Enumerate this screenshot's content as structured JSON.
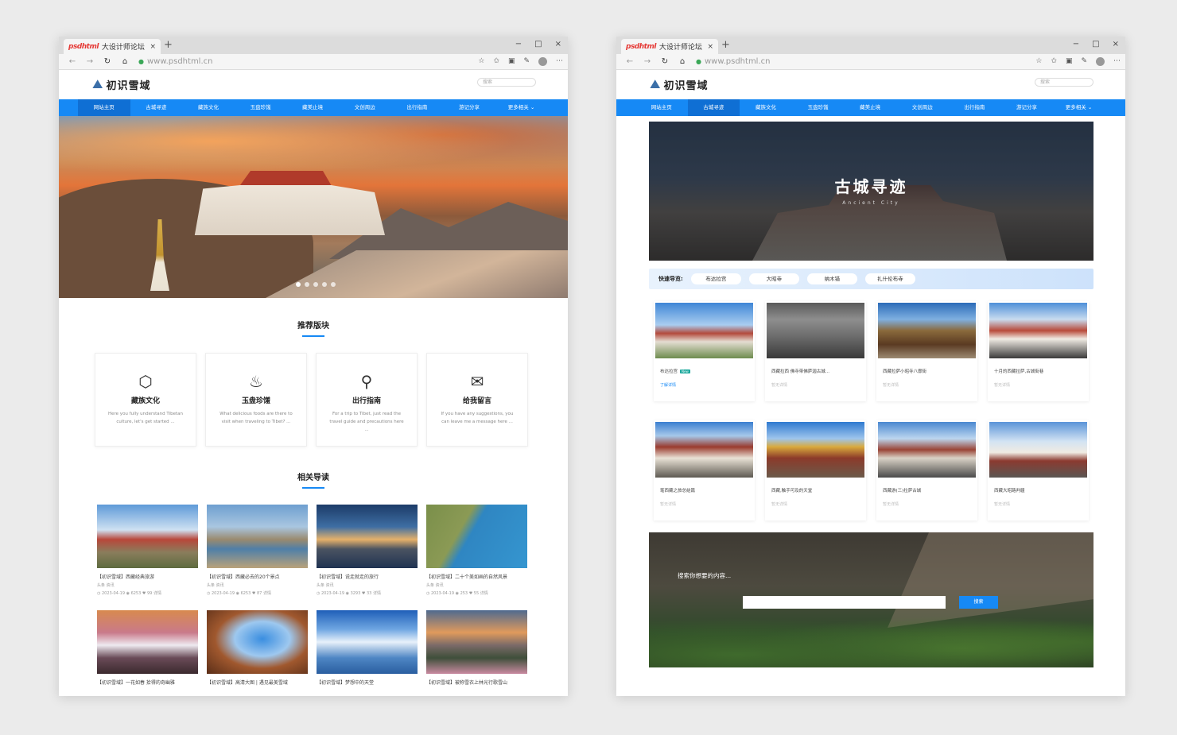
{
  "browser": {
    "tab_logo": "psdhtml",
    "tab_title": "大设计师论坛",
    "tab_close": "×",
    "new_tab": "+",
    "window_controls": [
      "−",
      "□",
      "×"
    ],
    "url": "www.psdhtml.cn",
    "nav_icons": [
      "back-icon",
      "forward-icon",
      "reload-icon",
      "home-icon"
    ],
    "tool_icons": [
      "star-icon",
      "favorites-icon",
      "collections-icon",
      "reading-icon",
      "profile-icon",
      "more-icon"
    ]
  },
  "site": {
    "logo_text": "初识雪域",
    "search_placeholder": "搜索",
    "nav": [
      "网站主页",
      "古城寻迹",
      "藏族文化",
      "玉盘珍馐",
      "藏美止境",
      "文创周边",
      "出行指南",
      "游记分享",
      "更多相关 ⌄"
    ]
  },
  "left": {
    "hero_dots": 5,
    "recommend_title": "推荐版块",
    "cards": [
      {
        "icon": "cube-icon",
        "title": "藏族文化",
        "desc": "Here you fully understand Tibetan culture, let's get started ..."
      },
      {
        "icon": "bowl-icon",
        "title": "玉盘珍馐",
        "desc": "What delicious foods are there to visit when traveling to Tibet? ..."
      },
      {
        "icon": "route-icon",
        "title": "出行指南",
        "desc": "For a trip to Tibet, just read the travel guide and precautions here ..."
      },
      {
        "icon": "message-icon",
        "title": "给我留言",
        "desc": "If you have any suggestions, you can leave me a message here ..."
      }
    ],
    "related_title": "相关导读",
    "posts": [
      {
        "title": "【初识雪域】西藏经典旅游",
        "meta": "头条 资讯",
        "date": "2023-04-19",
        "views": "6253",
        "likes": "99",
        "more": "详情"
      },
      {
        "title": "【初识雪域】西藏必去的20个景点",
        "meta": "头条 资讯",
        "date": "2023-04-19",
        "views": "6253",
        "likes": "87",
        "more": "详情"
      },
      {
        "title": "【初识雪域】说走就走的旅行",
        "meta": "头条 资讯",
        "date": "2023-04-19",
        "views": "3293",
        "likes": "33",
        "more": "详情"
      },
      {
        "title": "【初识雪域】二十个美如画的自然风景",
        "meta": "头条 资讯",
        "date": "2023-04-19",
        "views": "253",
        "likes": "55",
        "more": "详情"
      },
      {
        "title": "【初识雪域】一花如春 拾得的奇幽雅",
        "meta": "",
        "date": "",
        "views": "",
        "likes": "",
        "more": ""
      },
      {
        "title": "【初识雪域】高清大图 | 遇见最美雪域",
        "meta": "",
        "date": "",
        "views": "",
        "likes": "",
        "more": ""
      },
      {
        "title": "【初识雪域】梦想中的天堂",
        "meta": "",
        "date": "",
        "views": "",
        "likes": "",
        "more": ""
      },
      {
        "title": "【初识雪域】被称雪衣上林光行歌雪山",
        "meta": "",
        "date": "",
        "views": "",
        "likes": "",
        "more": ""
      }
    ]
  },
  "right": {
    "active_nav": 1,
    "banner_title": "古城寻迹",
    "banner_subtitle": "Ancient City",
    "quicknav_label": "快速导览:",
    "quicknav_tags": [
      "布达拉宫",
      "大昭寺",
      "纳木错",
      "扎什伦布寺"
    ],
    "sites": [
      {
        "title": "布达拉宫",
        "badge": "New",
        "link": "了解详情",
        "link_active": true
      },
      {
        "title": "西藏拉西 佛寺带佛萨迦古城...",
        "badge": "",
        "link": "暂无详情",
        "link_active": false
      },
      {
        "title": "西藏拉萨小昭寺八廓街",
        "badge": "",
        "link": "暂无详情",
        "link_active": false
      },
      {
        "title": "十月的西藏拉萨,古城街巷",
        "badge": "",
        "link": "暂无详情",
        "link_active": false
      },
      {
        "title": "笔西藏之旅总结篇",
        "badge": "",
        "link": "暂无详情",
        "link_active": false
      },
      {
        "title": "西藏,触手可及的天堂",
        "badge": "",
        "link": "暂无详情",
        "link_active": false
      },
      {
        "title": "西藏游(三)拉萨古城",
        "badge": "",
        "link": "暂无详情",
        "link_active": false
      },
      {
        "title": "西藏大昭路判疆",
        "badge": "",
        "link": "暂无详情",
        "link_active": false
      }
    ],
    "search_label": "搜索你想要的内容...",
    "search_button": "搜索"
  },
  "colors": {
    "accent": "#1689f5",
    "nav_active": "#0f6fd4",
    "badge": "#1aa89c"
  }
}
